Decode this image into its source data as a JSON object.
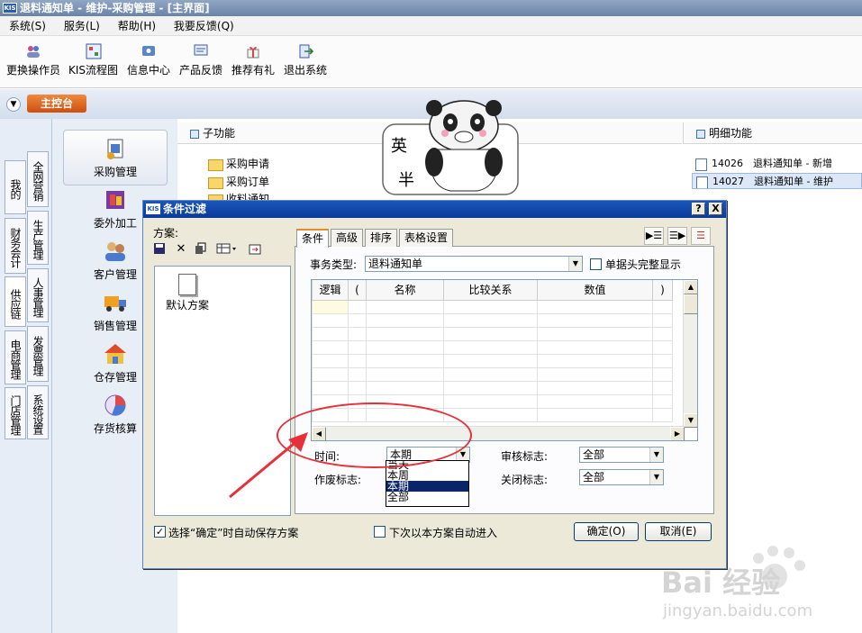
{
  "window": {
    "title": "退料通知单 - 维护-采购管理 - [主界面]",
    "logo": "KIS"
  },
  "menu": [
    "系统(S)",
    "服务(L)",
    "帮助(H)",
    "我要反馈(Q)"
  ],
  "toolbar": [
    "更换操作员",
    "KIS流程图",
    "信息中心",
    "产品反馈",
    "推荐有礼",
    "退出系统"
  ],
  "main_tab": "主控台",
  "left_tabs_col1": [
    "我的KIS",
    "财务会计",
    "供应链",
    "电商管理",
    "门店管理"
  ],
  "left_tabs_col2": [
    "全网营销",
    "生产管理",
    "人事管理",
    "发票管理",
    "系统设置"
  ],
  "modules": [
    "采购管理",
    "委外加工",
    "客户管理",
    "销售管理",
    "仓存管理",
    "存货核算"
  ],
  "sub": {
    "header": "子功能",
    "items": [
      "采购申请",
      "采购订单",
      "收料通知"
    ]
  },
  "detail": {
    "header": "明细功能",
    "items": [
      "14026　退料通知单 - 新增",
      "14027　退料通知单 - 维护"
    ]
  },
  "sticker": {
    "text1": "英",
    "text2": "半"
  },
  "dialog": {
    "title": "条件过滤",
    "logo": "KIS",
    "scheme_label": "方案:",
    "scheme_item": "默认方案",
    "tabs": [
      "条件",
      "高级",
      "排序",
      "表格设置"
    ],
    "biz_type_label": "事务类型:",
    "biz_type_value": "退料通知单",
    "full_header_label": "单据头完整显示",
    "columns": [
      "逻辑",
      "(",
      "名称",
      "比较关系",
      "数值",
      ")"
    ],
    "time_label": "时间:",
    "time_value": "本期",
    "time_options": [
      "当天",
      "本周",
      "本期",
      "全部"
    ],
    "time_options_selected": 2,
    "void_label": "作废标志:",
    "audit_label": "审核标志:",
    "audit_value": "全部",
    "close_label": "关闭标志:",
    "close_value": "全部",
    "auto_save_label": "选择“确定”时自动保存方案",
    "auto_enter_label": "下次以本方案自动进入",
    "ok_label": "确定(O)",
    "cancel_label": "取消(E)",
    "help_btn": "?",
    "close_btn": "X"
  },
  "watermark": {
    "brand": "Bai  经验",
    "url": "jingyan.baidu.com"
  },
  "colors": {
    "accent": "#e8303a",
    "title_blue": "#0b3b9a",
    "tab_orange": "#cc4f10"
  }
}
